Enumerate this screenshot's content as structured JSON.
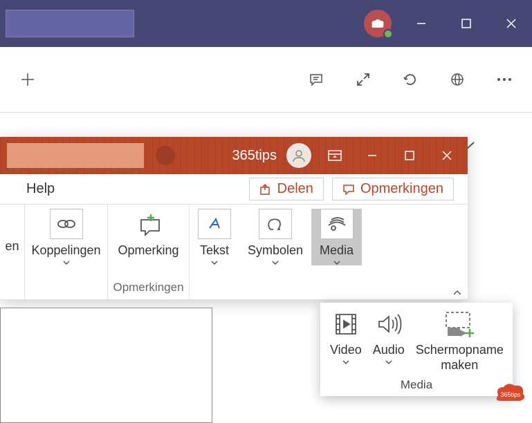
{
  "teams": {
    "titlebar": {
      "minimize": "—",
      "maximize": "❐",
      "close": "✕"
    }
  },
  "ppt": {
    "username": "365tips",
    "menubar": {
      "help": "Help",
      "share": "Delen",
      "comments": "Opmerkingen"
    },
    "ribbon": {
      "group_en_suffix": "en",
      "koppelingen": "Koppelingen",
      "opmerking": "Opmerking",
      "opmerkingen_group": "Opmerkingen",
      "tekst": "Tekst",
      "symbolen": "Symbolen",
      "media": "Media"
    },
    "dropdown": {
      "video": "Video",
      "audio": "Audio",
      "schermopname": "Schermopname maken",
      "footer": "Media"
    }
  },
  "badge": {
    "text": "365tips"
  }
}
